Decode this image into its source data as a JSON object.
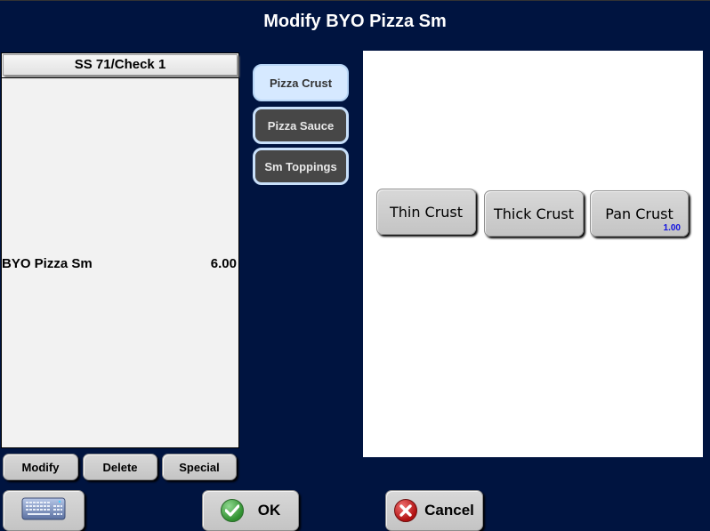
{
  "window": {
    "title": "Modify BYO Pizza Sm"
  },
  "check": {
    "header": "SS 71/Check 1",
    "items": [
      {
        "name": "BYO Pizza Sm",
        "price": "6.00"
      }
    ]
  },
  "check_actions": {
    "modify_label": "Modify",
    "delete_label": "Delete",
    "special_label": "Special"
  },
  "categories": [
    {
      "label": "Pizza Crust",
      "state": "active"
    },
    {
      "label": "Pizza Sauce",
      "state": "inactive"
    },
    {
      "label": "Sm Toppings",
      "state": "inactive"
    }
  ],
  "options": [
    {
      "label": "Thin Crust",
      "price": ""
    },
    {
      "label": "Thick Crust",
      "price": ""
    },
    {
      "label": "Pan Crust",
      "price": "1.00"
    }
  ],
  "footer": {
    "keyboard_icon": "keyboard-icon",
    "ok_label": "OK",
    "ok_icon": "check-circle-icon",
    "cancel_label": "Cancel",
    "cancel_icon": "x-circle-icon"
  },
  "colors": {
    "background": "#001440",
    "active_category": "#d6e9ff",
    "inactive_category": "#474747",
    "price_accent": "#1010e0",
    "ok_green": "#3a9a3a",
    "cancel_red": "#c01818"
  }
}
